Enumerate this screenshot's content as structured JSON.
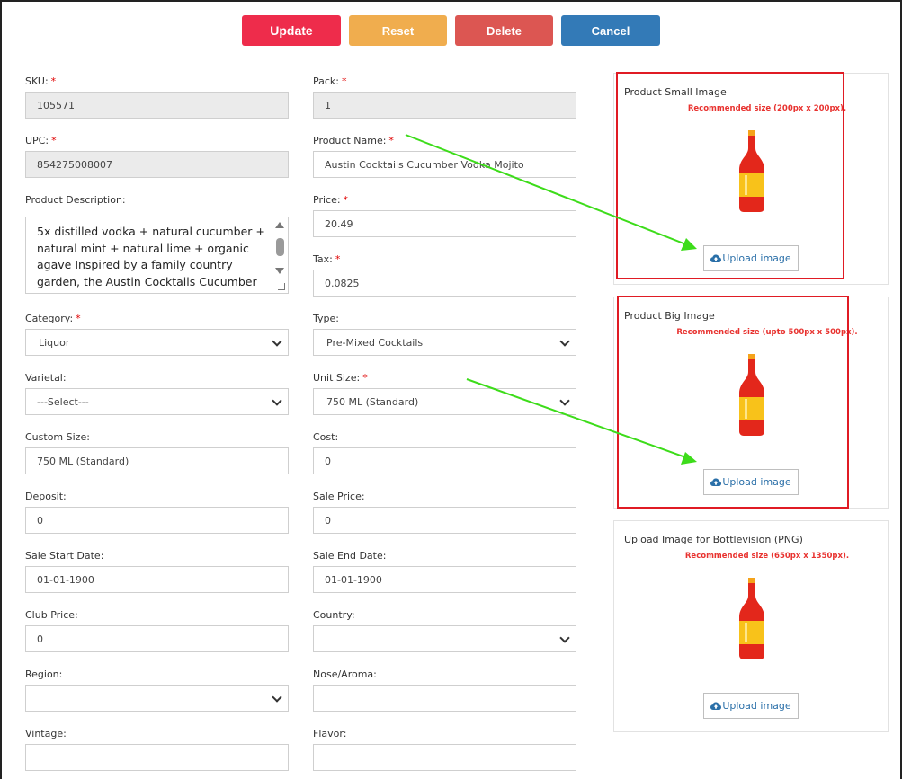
{
  "toolbar": {
    "update": "Update",
    "reset": "Reset",
    "delete": "Delete",
    "cancel": "Cancel"
  },
  "required_mark": "*",
  "fields": {
    "sku": {
      "label": "SKU:",
      "value": "105571"
    },
    "pack": {
      "label": "Pack:",
      "value": "1"
    },
    "upc": {
      "label": "UPC:",
      "value": "854275008007"
    },
    "product_name": {
      "label": "Product Name:",
      "value": "Austin Cocktails Cucumber Vodka Mojito"
    },
    "description": {
      "label": "Product Description:",
      "value": "5x distilled vodka + natural cucumber + natural mint + natural lime + organic agave Inspired by a family country garden, the Austin Cocktails Cucumber Vodka Mojito is meticulously crafted from the world"
    },
    "price": {
      "label": "Price:",
      "value": "20.49"
    },
    "tax": {
      "label": "Tax:",
      "value": "0.0825"
    },
    "category": {
      "label": "Category:",
      "value": "Liquor"
    },
    "type": {
      "label": "Type:",
      "value": "Pre-Mixed Cocktails"
    },
    "varietal": {
      "label": "Varietal:",
      "value": "---Select---"
    },
    "unit_size": {
      "label": "Unit Size:",
      "value": "750 ML (Standard)"
    },
    "custom_size": {
      "label": "Custom Size:",
      "value": "750 ML (Standard)"
    },
    "cost": {
      "label": "Cost:",
      "value": "0"
    },
    "deposit": {
      "label": "Deposit:",
      "value": "0"
    },
    "sale_price": {
      "label": "Sale Price:",
      "value": "0"
    },
    "sale_start": {
      "label": "Sale Start Date:",
      "value": "01-01-1900"
    },
    "sale_end": {
      "label": "Sale End Date:",
      "value": "01-01-1900"
    },
    "club_price": {
      "label": "Club Price:",
      "value": "0"
    },
    "country": {
      "label": "Country:",
      "value": ""
    },
    "region": {
      "label": "Region:",
      "value": ""
    },
    "nose": {
      "label": "Nose/Aroma:",
      "value": ""
    },
    "vintage": {
      "label": "Vintage:",
      "value": ""
    },
    "flavor": {
      "label": "Flavor:",
      "value": ""
    }
  },
  "images": {
    "small": {
      "title": "Product Small Image",
      "rec": "Recommended size (200px x 200px).",
      "button": "Upload image"
    },
    "big": {
      "title": "Product Big Image",
      "rec": "Recommended size (upto 500px x 500px).",
      "button": "Upload image"
    },
    "bottlevision": {
      "title": "Upload Image for Bottlevision (PNG)",
      "rec": "Recommended size (650px x 1350px).",
      "button": "Upload image"
    }
  },
  "colors": {
    "update": "#ee2c4b",
    "reset": "#f0ad4e",
    "delete": "#dc5652",
    "cancel": "#337ab7",
    "required": "#e00000",
    "recommend": "#e8322f",
    "highlight": "#e01b24",
    "arrow": "#3ddc1a",
    "link": "#2a6fa8"
  },
  "icons": {
    "upload": "cloud-upload-icon",
    "dropdown": "chevron-down-icon",
    "product": "bottle-icon"
  }
}
